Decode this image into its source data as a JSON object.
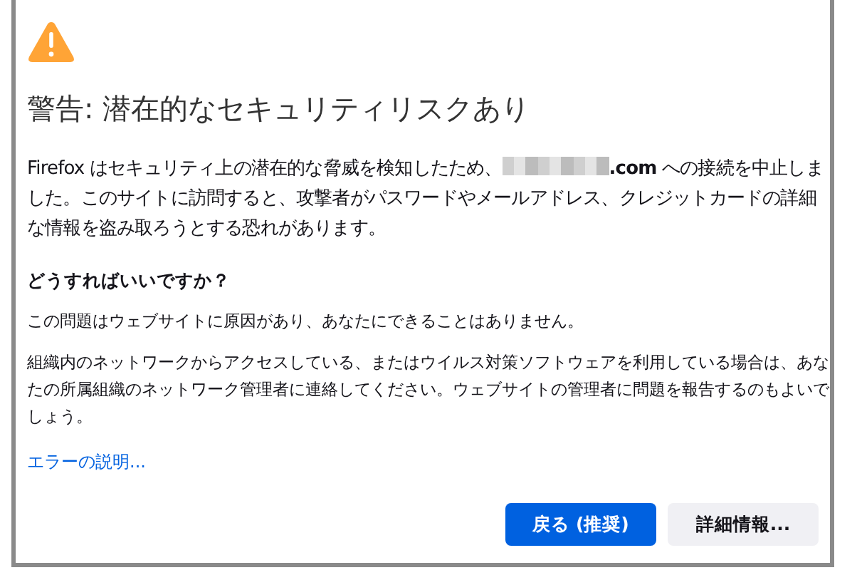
{
  "title": "警告: 潜在的なセキュリティリスクあり",
  "intro": {
    "before": "Firefox はセキュリティ上の潜在的な脅威を検知したため、",
    "redacted": true,
    "after": "**.com** への接続を中止しました。このサイトに訪問すると、攻撃者がパスワードやメールアドレス、クレジットカードの詳細な情報を盗み取ろうとする恐れがあります。"
  },
  "question": "どうすればいいですか？",
  "paragraphs": [
    "この問題はウェブサイトに原因があり、あなたにできることはありません。",
    "組織内のネットワークからアクセスしている、またはウイルス対策ソフトウェアを利用している場合は、あなたの所属組織のネットワーク管理者に連絡してください。ウェブサイトの管理者に問題を報告するのもよいでしょう。"
  ],
  "link": "エラーの説明...",
  "buttons": [
    {
      "label": "戻る (推奨)",
      "kind": "primary"
    },
    {
      "label": "詳細情報...",
      "kind": "secondary"
    }
  ]
}
